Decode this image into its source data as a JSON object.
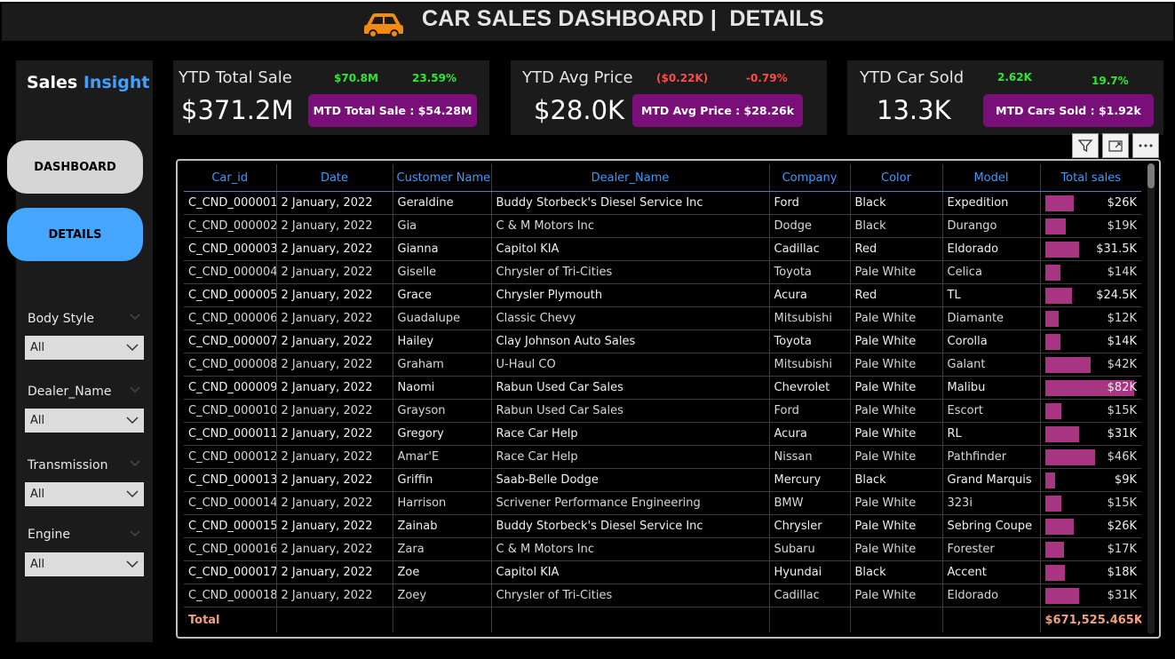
{
  "header": {
    "title": "CAR SALES DASHBOARD |  DETAILS",
    "icon": "car-icon",
    "icon_color": "#f28c0f"
  },
  "sidebar": {
    "brand_part1": "Sales",
    "brand_part2": "Insight",
    "nav": [
      {
        "label": "DASHBOARD",
        "active": false
      },
      {
        "label": "DETAILS",
        "active": true
      }
    ],
    "filters": [
      {
        "label": "Body Style",
        "value": "All"
      },
      {
        "label": "Dealer_Name",
        "value": "All"
      },
      {
        "label": "Transmission",
        "value": "All"
      },
      {
        "label": "Engine",
        "value": "All"
      }
    ]
  },
  "kpis": [
    {
      "label": "YTD Total Sale",
      "value": "$371.2M",
      "delta1": "$70.8M",
      "delta2": "23.59%",
      "mtd": "MTD Total Sale : $54.28M",
      "delta_color": "green"
    },
    {
      "label": "YTD Avg Price",
      "value": "$28.0K",
      "delta1": "($0.22K)",
      "delta2": "-0.79%",
      "mtd": "MTD Avg Price : $28.26k",
      "delta_color": "red"
    },
    {
      "label": "YTD Car Sold",
      "value": "13.3K",
      "delta1": "2.62K",
      "delta2": "19.7%",
      "mtd": "MTD Cars Sold : $1.92k",
      "delta_color": "green"
    }
  ],
  "colors": {
    "accent_blue": "#3a9cff",
    "mtd_purple": "#7a0f7a",
    "bar_magenta": "#a83581",
    "positive": "#2ee82e",
    "negative": "#ff4a4a",
    "total_text": "#f0a07a"
  },
  "table": {
    "columns": [
      "Car_id",
      "Date",
      "Customer Name",
      "Dealer_Name",
      "Company",
      "Color",
      "Model",
      "Total sales"
    ],
    "rows": [
      {
        "car_id": "C_CND_000001",
        "date": "2 January, 2022",
        "customer": "Geraldine",
        "dealer": "Buddy Storbeck's Diesel Service Inc",
        "company": "Ford",
        "color": "Black",
        "model": "Expedition",
        "sales": "$26K",
        "sales_value": 26
      },
      {
        "car_id": "C_CND_000002",
        "date": "2 January, 2022",
        "customer": "Gia",
        "dealer": "C & M Motors Inc",
        "company": "Dodge",
        "color": "Black",
        "model": "Durango",
        "sales": "$19K",
        "sales_value": 19
      },
      {
        "car_id": "C_CND_000003",
        "date": "2 January, 2022",
        "customer": "Gianna",
        "dealer": "Capitol KIA",
        "company": "Cadillac",
        "color": "Red",
        "model": "Eldorado",
        "sales": "$31.5K",
        "sales_value": 31.5
      },
      {
        "car_id": "C_CND_000004",
        "date": "2 January, 2022",
        "customer": "Giselle",
        "dealer": "Chrysler of Tri-Cities",
        "company": "Toyota",
        "color": "Pale White",
        "model": "Celica",
        "sales": "$14K",
        "sales_value": 14
      },
      {
        "car_id": "C_CND_000005",
        "date": "2 January, 2022",
        "customer": "Grace",
        "dealer": "Chrysler Plymouth",
        "company": "Acura",
        "color": "Red",
        "model": "TL",
        "sales": "$24.5K",
        "sales_value": 24.5
      },
      {
        "car_id": "C_CND_000006",
        "date": "2 January, 2022",
        "customer": "Guadalupe",
        "dealer": "Classic Chevy",
        "company": "Mitsubishi",
        "color": "Pale White",
        "model": "Diamante",
        "sales": "$12K",
        "sales_value": 12
      },
      {
        "car_id": "C_CND_000007",
        "date": "2 January, 2022",
        "customer": "Hailey",
        "dealer": "Clay Johnson Auto Sales",
        "company": "Toyota",
        "color": "Pale White",
        "model": "Corolla",
        "sales": "$14K",
        "sales_value": 14
      },
      {
        "car_id": "C_CND_000008",
        "date": "2 January, 2022",
        "customer": "Graham",
        "dealer": "U-Haul CO",
        "company": "Mitsubishi",
        "color": "Pale White",
        "model": "Galant",
        "sales": "$42K",
        "sales_value": 42
      },
      {
        "car_id": "C_CND_000009",
        "date": "2 January, 2022",
        "customer": "Naomi",
        "dealer": "Rabun Used Car Sales",
        "company": "Chevrolet",
        "color": "Pale White",
        "model": "Malibu",
        "sales": "$82K",
        "sales_value": 82
      },
      {
        "car_id": "C_CND_000010",
        "date": "2 January, 2022",
        "customer": "Grayson",
        "dealer": "Rabun Used Car Sales",
        "company": "Ford",
        "color": "Pale White",
        "model": "Escort",
        "sales": "$15K",
        "sales_value": 15
      },
      {
        "car_id": "C_CND_000011",
        "date": "2 January, 2022",
        "customer": "Gregory",
        "dealer": "Race Car Help",
        "company": "Acura",
        "color": "Pale White",
        "model": "RL",
        "sales": "$31K",
        "sales_value": 31
      },
      {
        "car_id": "C_CND_000012",
        "date": "2 January, 2022",
        "customer": "Amar'E",
        "dealer": "Race Car Help",
        "company": "Nissan",
        "color": "Pale White",
        "model": "Pathfinder",
        "sales": "$46K",
        "sales_value": 46
      },
      {
        "car_id": "C_CND_000013",
        "date": "2 January, 2022",
        "customer": "Griffin",
        "dealer": "Saab-Belle Dodge",
        "company": "Mercury",
        "color": "Black",
        "model": "Grand Marquis",
        "sales": "$9K",
        "sales_value": 9
      },
      {
        "car_id": "C_CND_000014",
        "date": "2 January, 2022",
        "customer": "Harrison",
        "dealer": "Scrivener Performance Engineering",
        "company": "BMW",
        "color": "Pale White",
        "model": "323i",
        "sales": "$15K",
        "sales_value": 15
      },
      {
        "car_id": "C_CND_000015",
        "date": "2 January, 2022",
        "customer": "Zainab",
        "dealer": "Buddy Storbeck's Diesel Service Inc",
        "company": "Chrysler",
        "color": "Pale White",
        "model": "Sebring Coupe",
        "sales": "$26K",
        "sales_value": 26
      },
      {
        "car_id": "C_CND_000016",
        "date": "2 January, 2022",
        "customer": "Zara",
        "dealer": "C & M Motors Inc",
        "company": "Subaru",
        "color": "Pale White",
        "model": "Forester",
        "sales": "$17K",
        "sales_value": 17
      },
      {
        "car_id": "C_CND_000017",
        "date": "2 January, 2022",
        "customer": "Zoe",
        "dealer": "Capitol KIA",
        "company": "Hyundai",
        "color": "Black",
        "model": "Accent",
        "sales": "$18K",
        "sales_value": 18
      },
      {
        "car_id": "C_CND_000018",
        "date": "2 January, 2022",
        "customer": "Zoey",
        "dealer": "Chrysler of Tri-Cities",
        "company": "Cadillac",
        "color": "Pale White",
        "model": "Eldorado",
        "sales": "$31K",
        "sales_value": 31
      }
    ],
    "total_label": "Total",
    "total_value": "$671,525.465K",
    "sales_max": 82
  },
  "visual_header_icons": [
    "filter-icon",
    "focus-mode-icon",
    "more-options-icon"
  ]
}
